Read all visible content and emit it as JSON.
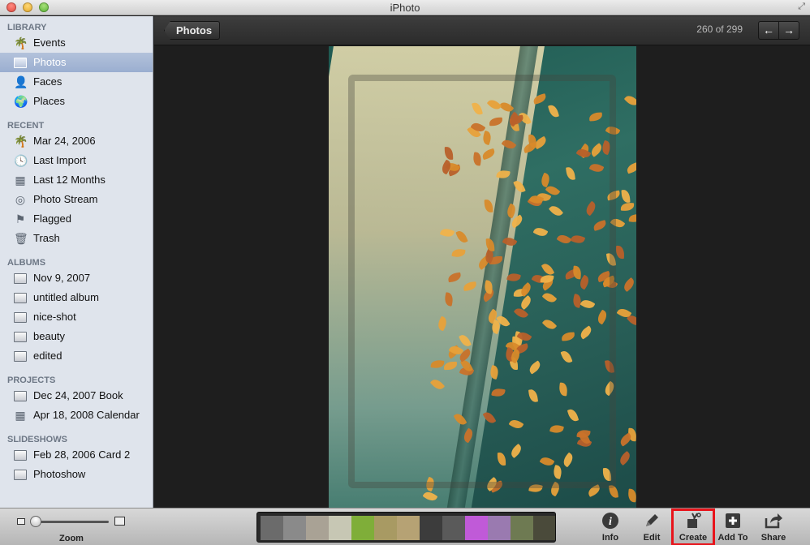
{
  "window": {
    "title": "iPhoto"
  },
  "sidebar": {
    "sections": [
      {
        "header": "LIBRARY",
        "items": [
          {
            "label": "Events",
            "icon": "palm-tree-icon"
          },
          {
            "label": "Photos",
            "icon": "photo-icon",
            "selected": true
          },
          {
            "label": "Faces",
            "icon": "person-icon"
          },
          {
            "label": "Places",
            "icon": "globe-icon"
          }
        ]
      },
      {
        "header": "RECENT",
        "items": [
          {
            "label": "Mar 24, 2006",
            "icon": "palm-tree-icon"
          },
          {
            "label": "Last Import",
            "icon": "clock-icon"
          },
          {
            "label": "Last 12 Months",
            "icon": "calendar-icon"
          },
          {
            "label": "Photo Stream",
            "icon": "photo-stream-icon"
          },
          {
            "label": "Flagged",
            "icon": "flag-icon"
          },
          {
            "label": "Trash",
            "icon": "trash-icon"
          }
        ]
      },
      {
        "header": "ALBUMS",
        "items": [
          {
            "label": "Nov 9, 2007",
            "icon": "album-icon"
          },
          {
            "label": "untitled album",
            "icon": "album-icon"
          },
          {
            "label": "nice-shot",
            "icon": "album-icon"
          },
          {
            "label": "beauty",
            "icon": "album-icon"
          },
          {
            "label": "edited",
            "icon": "album-icon"
          }
        ]
      },
      {
        "header": "PROJECTS",
        "items": [
          {
            "label": "Dec 24, 2007 Book",
            "icon": "book-icon"
          },
          {
            "label": "Apr 18, 2008 Calendar",
            "icon": "calendar-icon"
          }
        ]
      },
      {
        "header": "SLIDESHOWS",
        "items": [
          {
            "label": "Feb 28, 2006 Card 2",
            "icon": "slideshow-icon"
          },
          {
            "label": "Photoshow",
            "icon": "slideshow-icon"
          }
        ]
      }
    ]
  },
  "topbar": {
    "back_label": "Photos",
    "counter": "260 of 299",
    "prev_icon": "arrow-left-icon",
    "next_icon": "arrow-right-icon"
  },
  "bottombar": {
    "zoom_label": "Zoom",
    "zoom_level": 0.0,
    "tools": [
      {
        "label": "Info",
        "icon": "info-icon"
      },
      {
        "label": "Edit",
        "icon": "pencil-icon"
      },
      {
        "label": "Create",
        "icon": "create-icon",
        "highlighted": true
      },
      {
        "label": "Add To",
        "icon": "plus-icon"
      },
      {
        "label": "Share",
        "icon": "share-icon"
      }
    ]
  },
  "colors": {
    "sidebar_bg": "#dfe4ec",
    "selection": "#9aaed0",
    "viewer_bg": "#1e1e1e",
    "highlight": "#e8141b"
  }
}
